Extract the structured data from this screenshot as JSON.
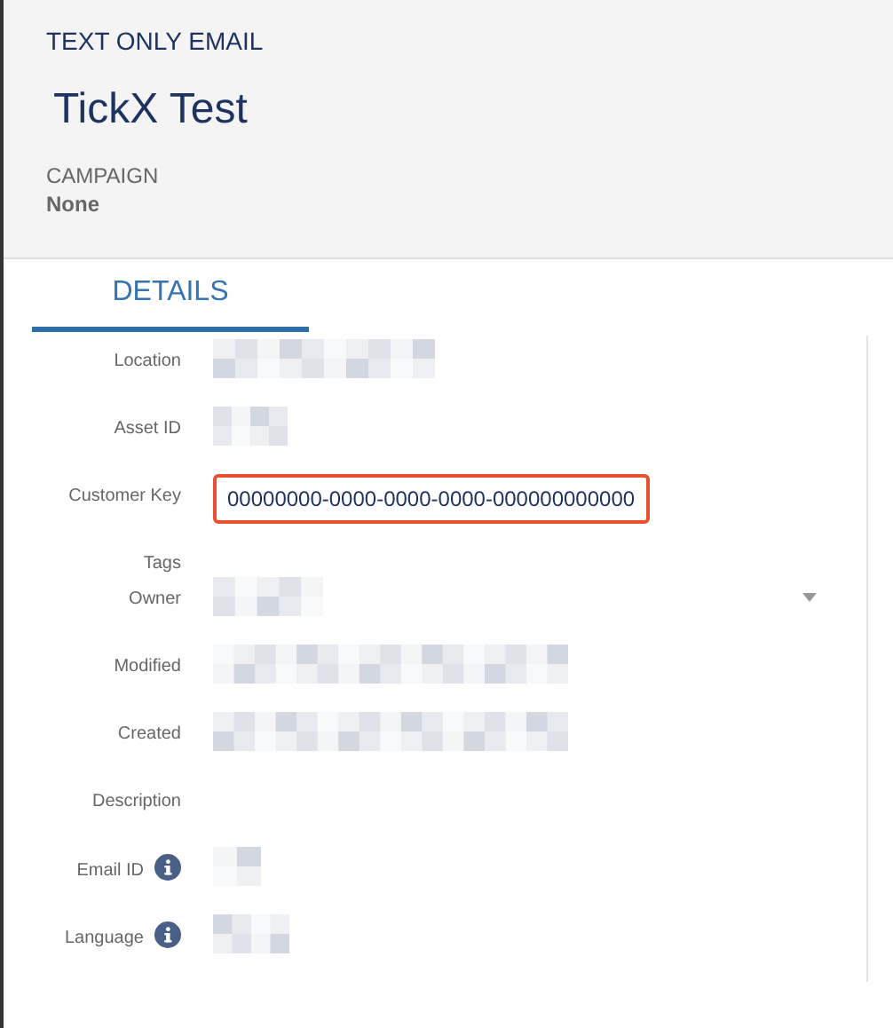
{
  "header": {
    "type_label": "TEXT ONLY EMAIL",
    "title": "TickX Test",
    "campaign_label": "CAMPAIGN",
    "campaign_value": "None"
  },
  "tabs": [
    {
      "label": "DETAILS",
      "selected": true
    }
  ],
  "fields": [
    {
      "label": "Location",
      "kind": "redacted",
      "info": false
    },
    {
      "label": "Asset ID",
      "kind": "redacted",
      "info": false
    },
    {
      "label": "Customer Key",
      "kind": "text",
      "value": "00000000-0000-0000-0000-000000000000",
      "highlighted": true,
      "info": false
    },
    {
      "label": "Tags",
      "kind": "empty",
      "info": false
    },
    {
      "label": "Owner",
      "kind": "dropdown",
      "info": false
    },
    {
      "label": "Modified",
      "kind": "redacted",
      "info": false
    },
    {
      "label": "Created",
      "kind": "redacted",
      "info": false
    },
    {
      "label": "Description",
      "kind": "empty",
      "info": false
    },
    {
      "label": "Email ID",
      "kind": "redacted",
      "info": true
    },
    {
      "label": "Language",
      "kind": "redacted",
      "info": true
    }
  ]
}
